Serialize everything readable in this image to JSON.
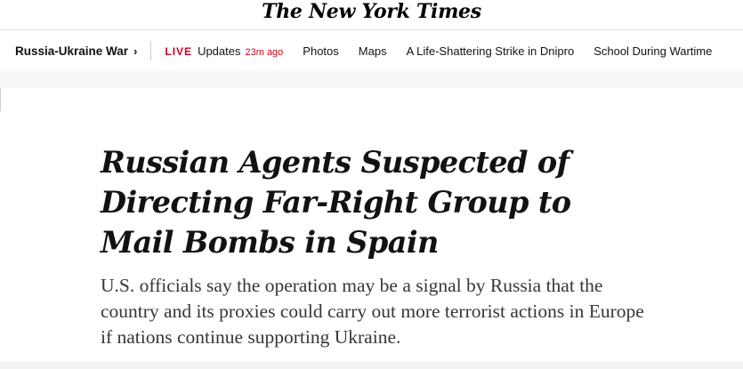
{
  "masthead": {
    "logo_text": "The New York Times"
  },
  "nav": {
    "section_label": "Russia-Ukraine War",
    "section_chevron": "›",
    "live_badge": "LIVE",
    "live_label": "Updates",
    "live_time": "23m ago",
    "links": [
      "Photos",
      "Maps",
      "A Life-Shattering Strike in Dnipro",
      "School During Wartime"
    ]
  },
  "article": {
    "headline": "Russian Agents Suspected of Directing Far-Right Group to Mail Bombs in Spain",
    "summary": "U.S. officials say the operation may be a signal by Russia that the country and its proxies could carry out more terrorist actions in Europe if nations continue supporting Ukraine."
  },
  "colors": {
    "live_red": "#d0021b",
    "text": "#121212",
    "summary_text": "#363636"
  }
}
